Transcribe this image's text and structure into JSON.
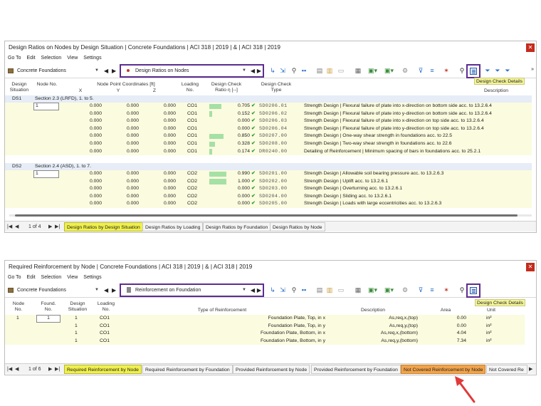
{
  "w1": {
    "title": "Design Ratios on Nodes by Design Situation | Concrete Foundations | ACI 318 | 2019 | & | ACI 318 | 2019",
    "menu": [
      "Go To",
      "Edit",
      "Selection",
      "View",
      "Settings"
    ],
    "module_select": "Concrete Foundations",
    "result_select": "Design Ratios on Nodes",
    "tooltip": "Design Check Details",
    "headers": {
      "design_situation": "Design Situation",
      "node_no": "Node No.",
      "coords": "Node Point Coordinates [ft]",
      "x": "X",
      "y": "Y",
      "z": "Z",
      "loading_no": "Loading No.",
      "ratio": "Design Check Ratio η [--]",
      "check_type": "Design Check Type",
      "description": "Description"
    },
    "ds1": {
      "name": "DS1",
      "section": "Section 2.3 (LRFD), 1. to 5.",
      "rows": [
        {
          "node": "1",
          "x": "0.000",
          "y": "0.000",
          "z": "0.000",
          "lc": "CO1",
          "ratio": "0.705",
          "check": "SD0206.01",
          "desc": "Strength Design | Flexural failure of plate into x-direction on bottom side acc. to 13.2.6.4"
        },
        {
          "node": "",
          "x": "0.000",
          "y": "0.000",
          "z": "0.000",
          "lc": "CO1",
          "ratio": "0.152",
          "check": "SD0206.02",
          "desc": "Strength Design | Flexural failure of plate into y-direction on bottom side acc. to 13.2.6.4"
        },
        {
          "node": "",
          "x": "0.000",
          "y": "0.000",
          "z": "0.000",
          "lc": "CO1",
          "ratio": "0.000",
          "check": "SD0206.03",
          "desc": "Strength Design | Flexural failure of plate into x-direction on top side acc. to 13.2.6.4"
        },
        {
          "node": "",
          "x": "0.000",
          "y": "0.000",
          "z": "0.000",
          "lc": "CO1",
          "ratio": "0.000",
          "check": "SD0206.04",
          "desc": "Strength Design | Flexural failure of plate into y-direction on top side acc. to 13.2.6.4"
        },
        {
          "node": "",
          "x": "0.000",
          "y": "0.000",
          "z": "0.000",
          "lc": "CO1",
          "ratio": "0.850",
          "check": "SD0207.00",
          "desc": "Strength Design | One-way shear strength in foundations acc. to 22.5"
        },
        {
          "node": "",
          "x": "0.000",
          "y": "0.000",
          "z": "0.000",
          "lc": "CO1",
          "ratio": "0.328",
          "check": "SD0208.00",
          "desc": "Strength Design | Two-way shear strength in foundations acc. to 22.6"
        },
        {
          "node": "",
          "x": "0.000",
          "y": "0.000",
          "z": "0.000",
          "lc": "CO1",
          "ratio": "0.174",
          "check": "DR0240.00",
          "desc": "Detailing of Reinforcement | Minimum spacing of bars in foundations acc. to 25.2.1"
        }
      ]
    },
    "ds2": {
      "name": "DS2",
      "section": "Section 2.4 (ASD), 1. to 7.",
      "rows": [
        {
          "node": "1",
          "x": "0.000",
          "y": "0.000",
          "z": "0.000",
          "lc": "CO2",
          "ratio": "0.990",
          "check": "SD0201.00",
          "desc": "Strength Design | Allowable soil bearing pressure acc. to 13.2.6.3"
        },
        {
          "node": "",
          "x": "0.000",
          "y": "0.000",
          "z": "0.000",
          "lc": "CO2",
          "ratio": "1.000",
          "check": "SD0202.00",
          "desc": "Strength Design | Uplift acc. to 13.2.6.1"
        },
        {
          "node": "",
          "x": "0.000",
          "y": "0.000",
          "z": "0.000",
          "lc": "CO2",
          "ratio": "0.000",
          "check": "SD0203.00",
          "desc": "Strength Design | Overturning acc. to 13.2.6.1"
        },
        {
          "node": "",
          "x": "0.000",
          "y": "0.000",
          "z": "0.000",
          "lc": "CO2",
          "ratio": "0.000",
          "check": "SD0204.00",
          "desc": "Strength Design | Sliding acc. to 13.2.6.1"
        },
        {
          "node": "",
          "x": "0.000",
          "y": "0.000",
          "z": "0.000",
          "lc": "CO2",
          "ratio": "0.000",
          "check": "SD0205.00",
          "desc": "Strength Design | Loads with large eccentricities acc. to 13.2.6.3"
        }
      ]
    },
    "pager": "1 of 4",
    "tabs": [
      "Design Ratios by Design Situation",
      "Design Ratios by Loading",
      "Design Ratios by Foundation",
      "Design Ratios by Node"
    ]
  },
  "w2": {
    "title": "Required Reinforcement by Node | Concrete Foundations | ACI 318 | 2019 | & | ACI 318 | 2019",
    "menu": [
      "Go To",
      "Edit",
      "Selection",
      "View",
      "Settings"
    ],
    "module_select": "Concrete Foundations",
    "result_select": "Reinforcement on Foundation",
    "tooltip": "Design Check Details",
    "headers": {
      "node_no": "Node No.",
      "found_no": "Found. No.",
      "design_situation": "Design Situation",
      "loading_no": "Loading No.",
      "type": "Type of Reinforcement",
      "description": "Description",
      "area": "Area",
      "unit": "Unit"
    },
    "rows": [
      {
        "node": "1",
        "found": "1",
        "ds": "1",
        "lc": "CO1",
        "type": "Foundation Plate, Top, in x",
        "desc_sym": "As,req,x,(top)",
        "area": "0.00",
        "unit": "in²"
      },
      {
        "node": "",
        "found": "",
        "ds": "1",
        "lc": "CO1",
        "type": "Foundation Plate, Top, in y",
        "desc_sym": "As,req,y,(top)",
        "area": "0.00",
        "unit": "in²"
      },
      {
        "node": "",
        "found": "",
        "ds": "1",
        "lc": "CO1",
        "type": "Foundation Plate, Bottom, in x",
        "desc_sym": "As,req,x,(bottom)",
        "area": "4.04",
        "unit": "in²"
      },
      {
        "node": "",
        "found": "",
        "ds": "1",
        "lc": "CO1",
        "type": "Foundation Plate, Bottom, in y",
        "desc_sym": "As,req,y,(bottom)",
        "area": "7.34",
        "unit": "in²"
      }
    ],
    "pager": "1 of 6",
    "tabs": [
      "Required Reinforcement by Node",
      "Required Reinforcement by Foundation",
      "Provided Reinforcement by Node",
      "Provided Reinforcement by Foundation",
      "Not Covered Reinforcement by Node",
      "Not Covered Re"
    ]
  },
  "colors": {
    "highlight_tab": "#f0f04c",
    "orange_tab": "#f2a34a",
    "frame": "#5c2d91",
    "bar": "#a5e0a5",
    "row_bg": "#fbfbdf",
    "arrow": "#e03a3a"
  }
}
